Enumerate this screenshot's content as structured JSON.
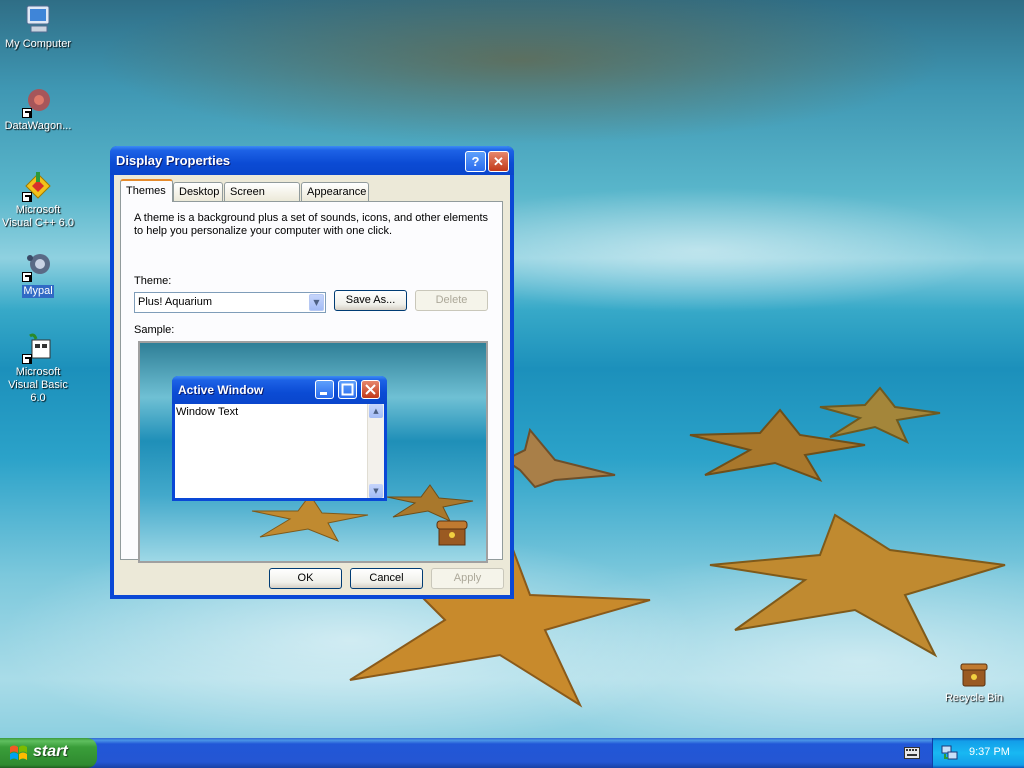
{
  "desktop": {
    "icons": [
      {
        "label": "My Computer",
        "selected": false,
        "icon": "my-computer-icon"
      },
      {
        "label": "DataWagon...",
        "selected": false,
        "icon": "datawagon-icon"
      },
      {
        "label": "Microsoft Visual C++ 6.0",
        "selected": false,
        "icon": "visual-cpp-icon"
      },
      {
        "label": "Mypal",
        "selected": true,
        "icon": "mypal-icon"
      },
      {
        "label": "Microsoft Visual Basic 6.0",
        "selected": false,
        "icon": "visual-basic-icon"
      },
      {
        "label": "Recycle Bin",
        "selected": false,
        "icon": "recycle-bin-icon"
      }
    ]
  },
  "dialog": {
    "title": "Display Properties",
    "help_glyph": "?",
    "close_glyph": "✕",
    "tabs": [
      {
        "label": "Themes",
        "active": true
      },
      {
        "label": "Desktop",
        "active": false
      },
      {
        "label": "Screen Saver",
        "active": false
      },
      {
        "label": "Appearance",
        "active": false
      }
    ],
    "description_line1": "A theme is a background plus a set of sounds, icons, and other elements",
    "description_line2": "to help you personalize your computer with one click.",
    "theme_label": "Theme:",
    "theme_value": "Plus! Aquarium",
    "save_as_label": "Save As...",
    "delete_label": "Delete",
    "sample_label": "Sample:",
    "sample": {
      "window_title": "Active Window",
      "window_text": "Window Text"
    },
    "ok_label": "OK",
    "cancel_label": "Cancel",
    "apply_label": "Apply",
    "accent_color": "#0a48d6"
  },
  "taskbar": {
    "start_label": "start",
    "clock": "9:37 PM",
    "tray_icons": [
      "keyboard-icon",
      "network-icon"
    ]
  }
}
